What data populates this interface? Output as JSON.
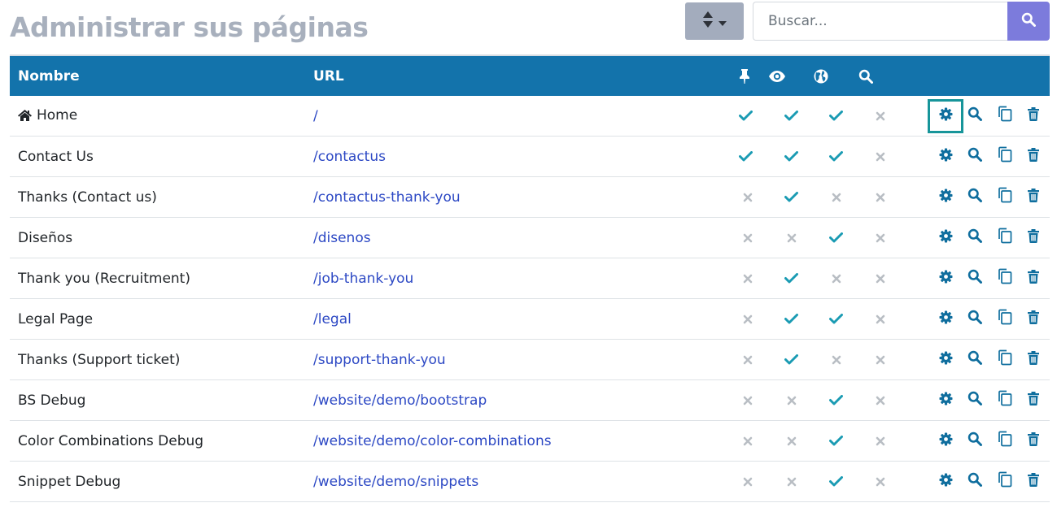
{
  "header": {
    "title": "Administrar sus páginas",
    "search_placeholder": "Buscar..."
  },
  "table": {
    "columns": {
      "name": "Nombre",
      "url": "URL",
      "flags": [
        "pin-icon",
        "eye-icon",
        "globe-icon",
        "search-icon"
      ]
    },
    "rows": [
      {
        "name": "Home",
        "url": "/",
        "home_icon": true,
        "pinned": true,
        "visible": true,
        "published": true,
        "indexed": false
      },
      {
        "name": "Contact Us",
        "url": "/contactus",
        "pinned": true,
        "visible": true,
        "published": true,
        "indexed": false
      },
      {
        "name": "Thanks (Contact us)",
        "url": "/contactus-thank-you",
        "pinned": false,
        "visible": true,
        "published": false,
        "indexed": false
      },
      {
        "name": "Diseños",
        "url": "/disenos",
        "pinned": false,
        "visible": false,
        "published": true,
        "indexed": false
      },
      {
        "name": "Thank you (Recruitment)",
        "url": "/job-thank-you",
        "pinned": false,
        "visible": true,
        "published": false,
        "indexed": false
      },
      {
        "name": "Legal Page",
        "url": "/legal",
        "pinned": false,
        "visible": true,
        "published": true,
        "indexed": false
      },
      {
        "name": "Thanks (Support ticket)",
        "url": "/support-thank-you",
        "pinned": false,
        "visible": true,
        "published": false,
        "indexed": false
      },
      {
        "name": "BS Debug",
        "url": "/website/demo/bootstrap",
        "pinned": false,
        "visible": false,
        "published": true,
        "indexed": false
      },
      {
        "name": "Color Combinations Debug",
        "url": "/website/demo/color-combinations",
        "pinned": false,
        "visible": false,
        "published": true,
        "indexed": false
      },
      {
        "name": "Snippet Debug",
        "url": "/website/demo/snippets",
        "pinned": false,
        "visible": false,
        "published": true,
        "indexed": false
      }
    ],
    "row_actions": [
      "gear-icon",
      "search-icon",
      "copy-icon",
      "trash-icon"
    ],
    "focused_action": {
      "row": 0,
      "action": "gear-icon"
    }
  },
  "colors": {
    "header_bg": "#1373ab",
    "check": "#1a9bb3",
    "cross": "#b9bec4",
    "action_icon": "#0f6e9e",
    "link": "#2c48c4",
    "focus_outline": "#17959a",
    "search_button": "#7c7bdc",
    "sort_button": "#a3acbd"
  }
}
